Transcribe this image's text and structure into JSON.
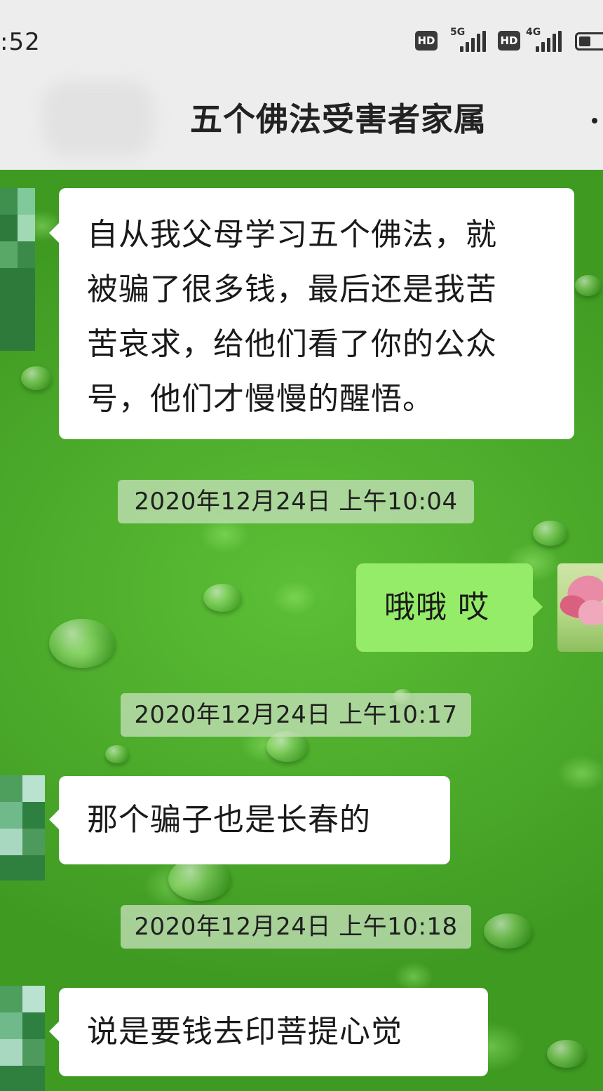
{
  "status_bar": {
    "time": ":52",
    "hd_label": "HD",
    "network_1": "5G",
    "network_2": "4G",
    "battery_level": 0.45
  },
  "chat": {
    "title": "五个佛法受害者家属",
    "more_icon": "more-dots-icon"
  },
  "messages": [
    {
      "side": "left",
      "text": "自从我父母学习五个佛法，就\n被骗了很多钱，最后还是我苦\n苦哀求，给他们看了你的公众\n号，他们才慢慢的醒悟。"
    },
    {
      "type": "timestamp",
      "text": "2020年12月24日 上午10:04"
    },
    {
      "side": "right",
      "text": "哦哦 哎"
    },
    {
      "type": "timestamp",
      "text": "2020年12月24日 上午10:17"
    },
    {
      "side": "left",
      "text": "那个骗子也是长春的"
    },
    {
      "type": "timestamp",
      "text": "2020年12月24日 上午10:18"
    },
    {
      "side": "left",
      "text": "说是要钱去印菩提心觉"
    }
  ],
  "colors": {
    "incoming_bubble": "#ffffff",
    "outgoing_bubble": "#95ec69",
    "header_background": "#ededed",
    "chat_wallpaper": "#4caa2c"
  }
}
